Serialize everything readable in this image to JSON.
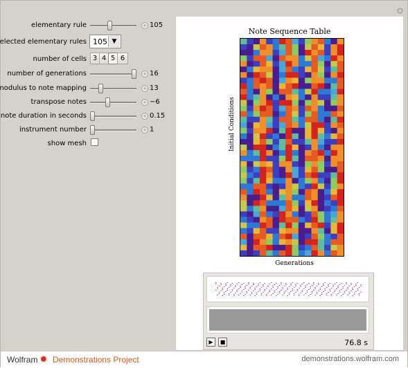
{
  "controls": {
    "elementary_rule": {
      "label": "elementary rule",
      "value": "105",
      "level": 0.41
    },
    "selected_rules": {
      "label": "selected elementary rules",
      "value": "105"
    },
    "cells": {
      "label": "number of cells",
      "options": [
        "3",
        "4",
        "5",
        "6"
      ],
      "selected": "5"
    },
    "generations": {
      "label": "number of generations",
      "value": "16",
      "level": 1.0
    },
    "modulus": {
      "label": "modulus to note mapping",
      "value": "13",
      "level": 0.12
    },
    "transpose": {
      "label": "transpose notes",
      "value": "−6",
      "level": 0.35
    },
    "duration": {
      "label": "note duration in seconds",
      "value": "0.15",
      "level": 0.0
    },
    "instrument": {
      "label": "instrument number",
      "value": "1",
      "level": 0.0
    },
    "mesh": {
      "label": "show mesh",
      "checked": false
    }
  },
  "plot": {
    "title": "Note Sequence Table",
    "xlabel": "Generations",
    "ylabel": "Initial Conditions"
  },
  "player": {
    "duration": "76.8 s"
  },
  "footer": {
    "brand": "Wolfram",
    "project": "Demonstrations Project",
    "url": "demonstrations.wolfram.com"
  }
}
